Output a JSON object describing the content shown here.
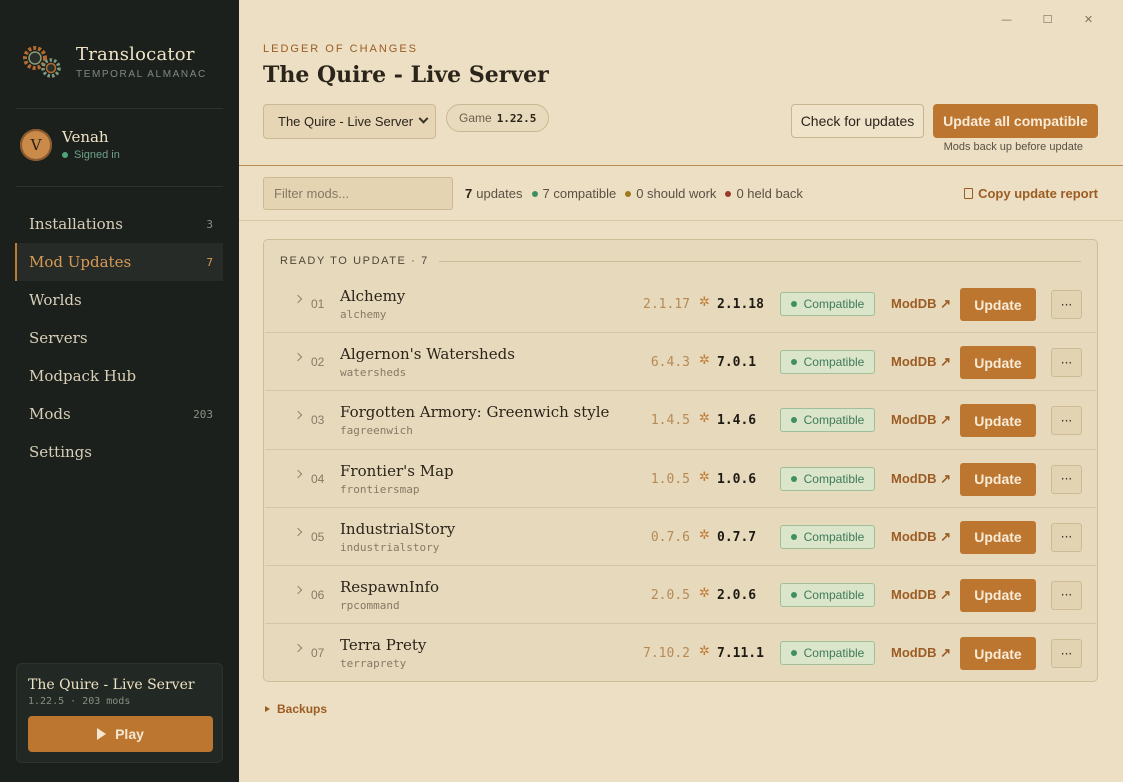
{
  "brand": {
    "title": "Translocator",
    "subtitle": "TEMPORAL ALMANAC"
  },
  "user": {
    "initial": "V",
    "name": "Venah",
    "status": "Signed in"
  },
  "nav": [
    {
      "label": "Installations",
      "count": "3",
      "active": false
    },
    {
      "label": "Mod Updates",
      "count": "7",
      "active": true
    },
    {
      "label": "Worlds",
      "count": "",
      "active": false
    },
    {
      "label": "Servers",
      "count": "",
      "active": false
    },
    {
      "label": "Modpack Hub",
      "count": "",
      "active": false
    },
    {
      "label": "Mods",
      "count": "203",
      "active": false
    },
    {
      "label": "Settings",
      "count": "",
      "active": false
    }
  ],
  "server_card": {
    "name": "The Quire - Live Server",
    "meta": "1.22.5 · 203 mods",
    "play_label": "Play"
  },
  "window": {
    "minimize": "—",
    "maximize": "☐",
    "close": "✕"
  },
  "header": {
    "eyebrow": "LEDGER OF CHANGES",
    "title": "The Quire - Live Server",
    "installation_select": "The Quire - Live Server",
    "game_label": "Game",
    "game_version": "1.22.5",
    "check_label": "Check for updates",
    "update_all_label": "Update all compatible",
    "backup_note": "Mods back up before update"
  },
  "toolbar": {
    "filter_placeholder": "Filter mods...",
    "updates_count": "7",
    "updates_label": "updates",
    "compatible": "7 compatible",
    "should_work": "0 should work",
    "held_back": "0 held back",
    "copy_report": "Copy update report"
  },
  "colors": {
    "accent": "#bd7630",
    "compatible": "#3f8f63",
    "should_work": "#a0781e",
    "held_back": "#9a3a2a"
  },
  "panel": {
    "heading": "READY TO UPDATE · 7",
    "rows": [
      {
        "index": "01",
        "name": "Alchemy",
        "id": "alchemy",
        "from": "2.1.17",
        "to": "2.1.18",
        "status": "Compatible",
        "link": "ModDB ↗",
        "action": "Update",
        "more": "···"
      },
      {
        "index": "02",
        "name": "Algernon's Watersheds",
        "id": "watersheds",
        "from": "6.4.3",
        "to": "7.0.1",
        "status": "Compatible",
        "link": "ModDB ↗",
        "action": "Update",
        "more": "···"
      },
      {
        "index": "03",
        "name": "Forgotten Armory: Greenwich style",
        "id": "fagreenwich",
        "from": "1.4.5",
        "to": "1.4.6",
        "status": "Compatible",
        "link": "ModDB ↗",
        "action": "Update",
        "more": "···"
      },
      {
        "index": "04",
        "name": "Frontier's Map",
        "id": "frontiersmap",
        "from": "1.0.5",
        "to": "1.0.6",
        "status": "Compatible",
        "link": "ModDB ↗",
        "action": "Update",
        "more": "···"
      },
      {
        "index": "05",
        "name": "IndustrialStory",
        "id": "industrialstory",
        "from": "0.7.6",
        "to": "0.7.7",
        "status": "Compatible",
        "link": "ModDB ↗",
        "action": "Update",
        "more": "···"
      },
      {
        "index": "06",
        "name": "RespawnInfo",
        "id": "rpcommand",
        "from": "2.0.5",
        "to": "2.0.6",
        "status": "Compatible",
        "link": "ModDB ↗",
        "action": "Update",
        "more": "···"
      },
      {
        "index": "07",
        "name": "Terra Prety",
        "id": "terraprety",
        "from": "7.10.2",
        "to": "7.11.1",
        "status": "Compatible",
        "link": "ModDB ↗",
        "action": "Update",
        "more": "···"
      }
    ]
  },
  "backups_label": "Backups"
}
